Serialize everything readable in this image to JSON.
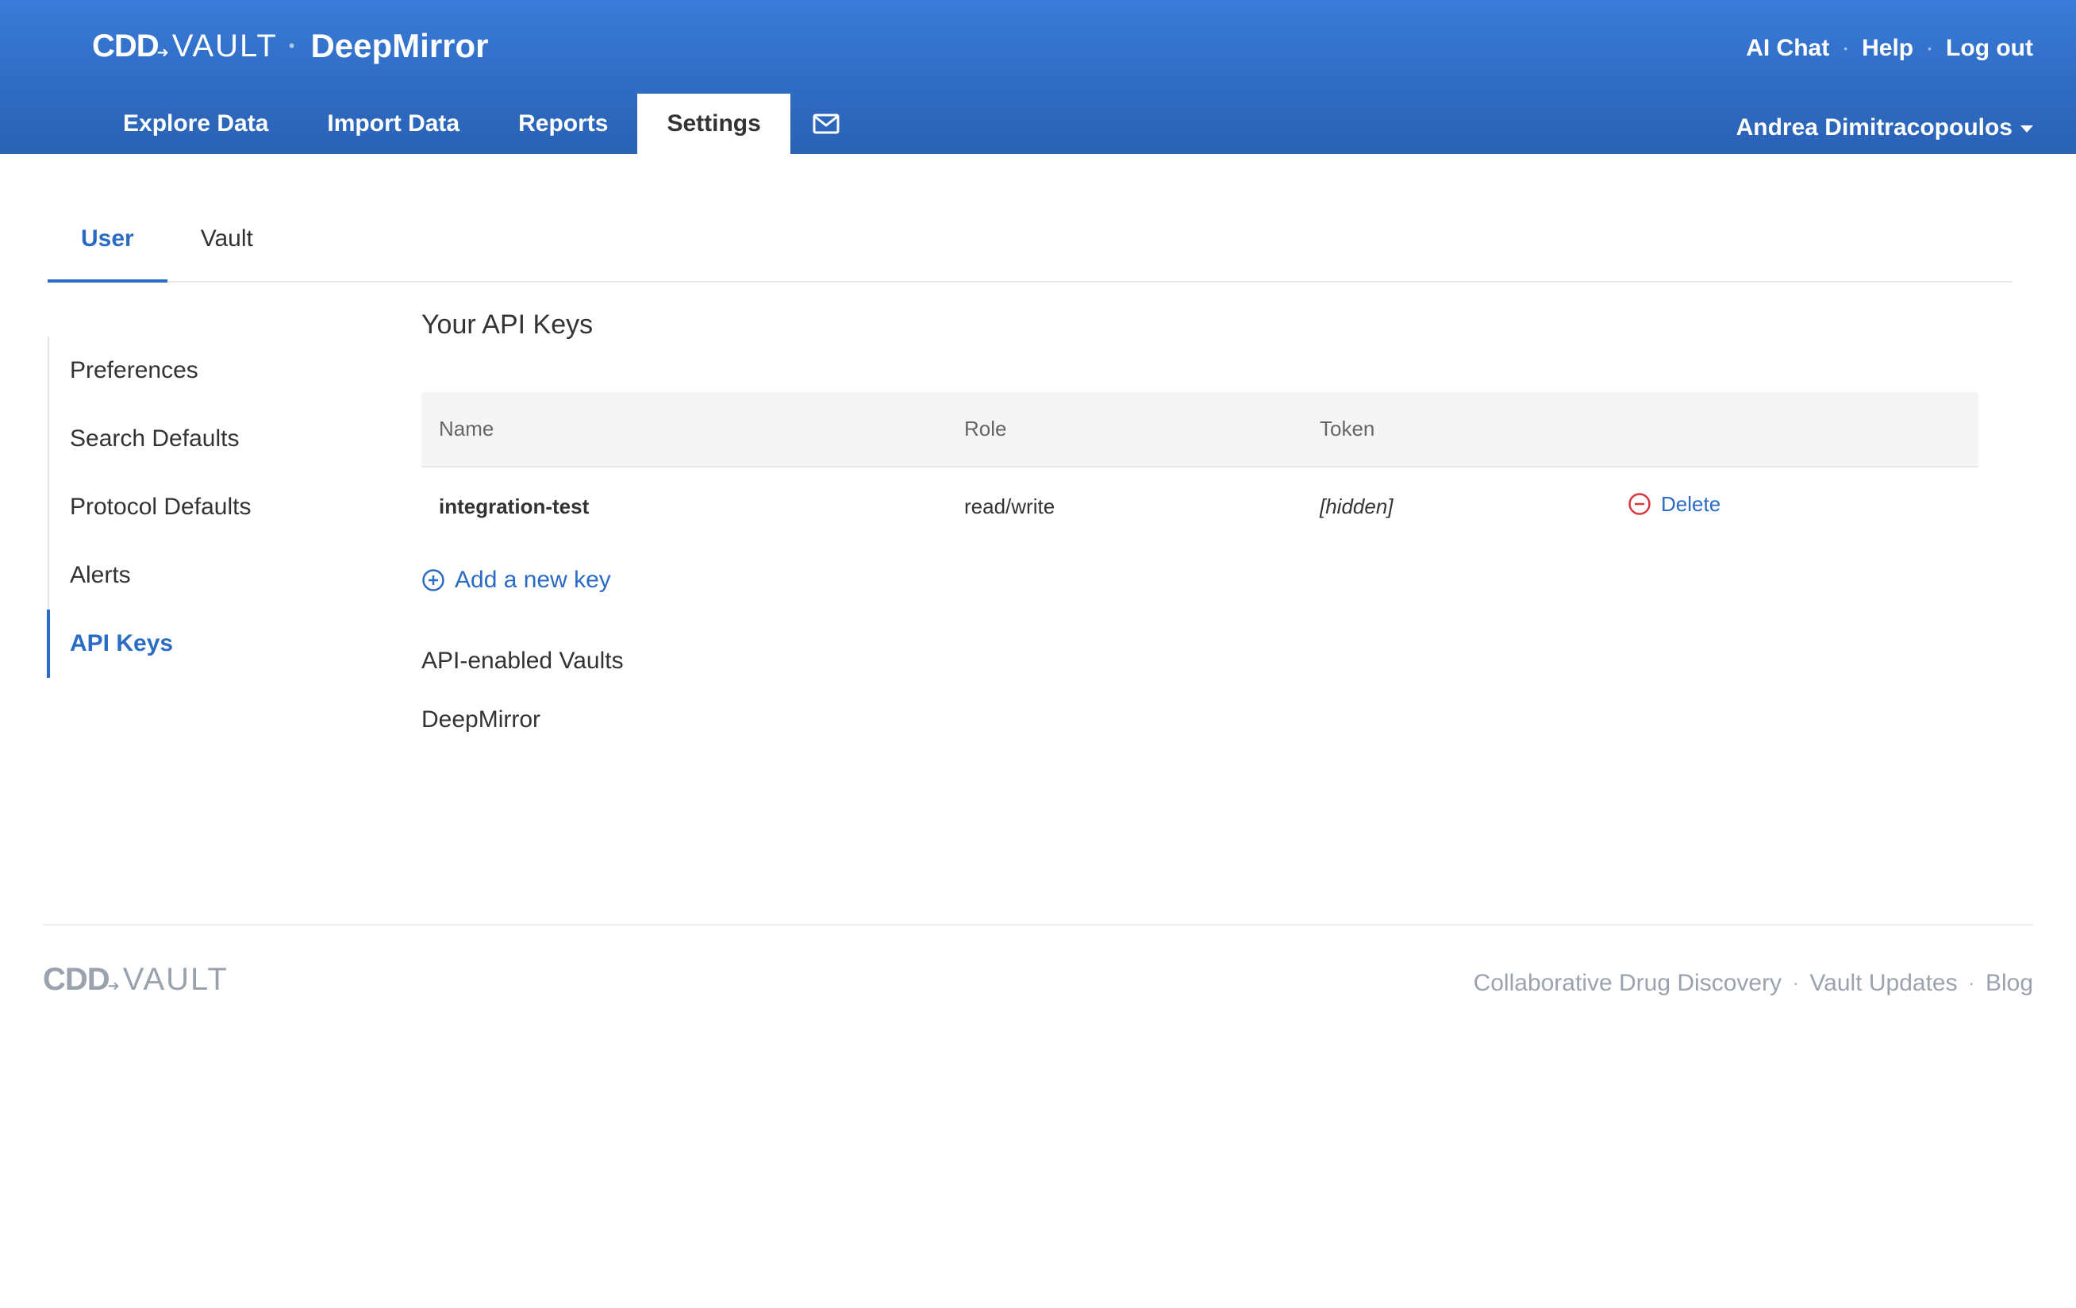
{
  "header": {
    "logo": {
      "cdd": "CDD",
      "vault": "VAULT"
    },
    "vault_name": "DeepMirror",
    "nav": [
      {
        "label": "Explore Data"
      },
      {
        "label": "Import Data"
      },
      {
        "label": "Reports"
      },
      {
        "label": "Settings",
        "active": true
      }
    ],
    "mail_icon": "envelope-icon",
    "top_links": [
      "AI Chat",
      "Help",
      "Log out"
    ],
    "user_name": "Andrea Dimitracopoulos"
  },
  "subtabs": [
    {
      "label": "User",
      "active": true
    },
    {
      "label": "Vault"
    }
  ],
  "sidenav": [
    {
      "label": "Preferences"
    },
    {
      "label": "Search Defaults"
    },
    {
      "label": "Protocol Defaults"
    },
    {
      "label": "Alerts"
    },
    {
      "label": "API Keys",
      "active": true
    }
  ],
  "main": {
    "title": "Your API Keys",
    "table": {
      "headers": [
        "Name",
        "Role",
        "Token",
        ""
      ],
      "rows": [
        {
          "name": "integration-test",
          "role": "read/write",
          "token": "[hidden]",
          "action": "Delete"
        }
      ]
    },
    "add_key_label": "Add a new key",
    "enabled_title": "API-enabled Vaults",
    "enabled_vaults": [
      "DeepMirror"
    ]
  },
  "footer": {
    "logo": {
      "cdd": "CDD",
      "vault": "VAULT"
    },
    "links": [
      "Collaborative Drug Discovery",
      "Vault Updates",
      "Blog"
    ]
  },
  "colors": {
    "header_blue": "#2f6cc4",
    "link_blue": "#2a6bc6",
    "delete_red": "#d9363e",
    "footer_gray": "#9aa3ad"
  }
}
